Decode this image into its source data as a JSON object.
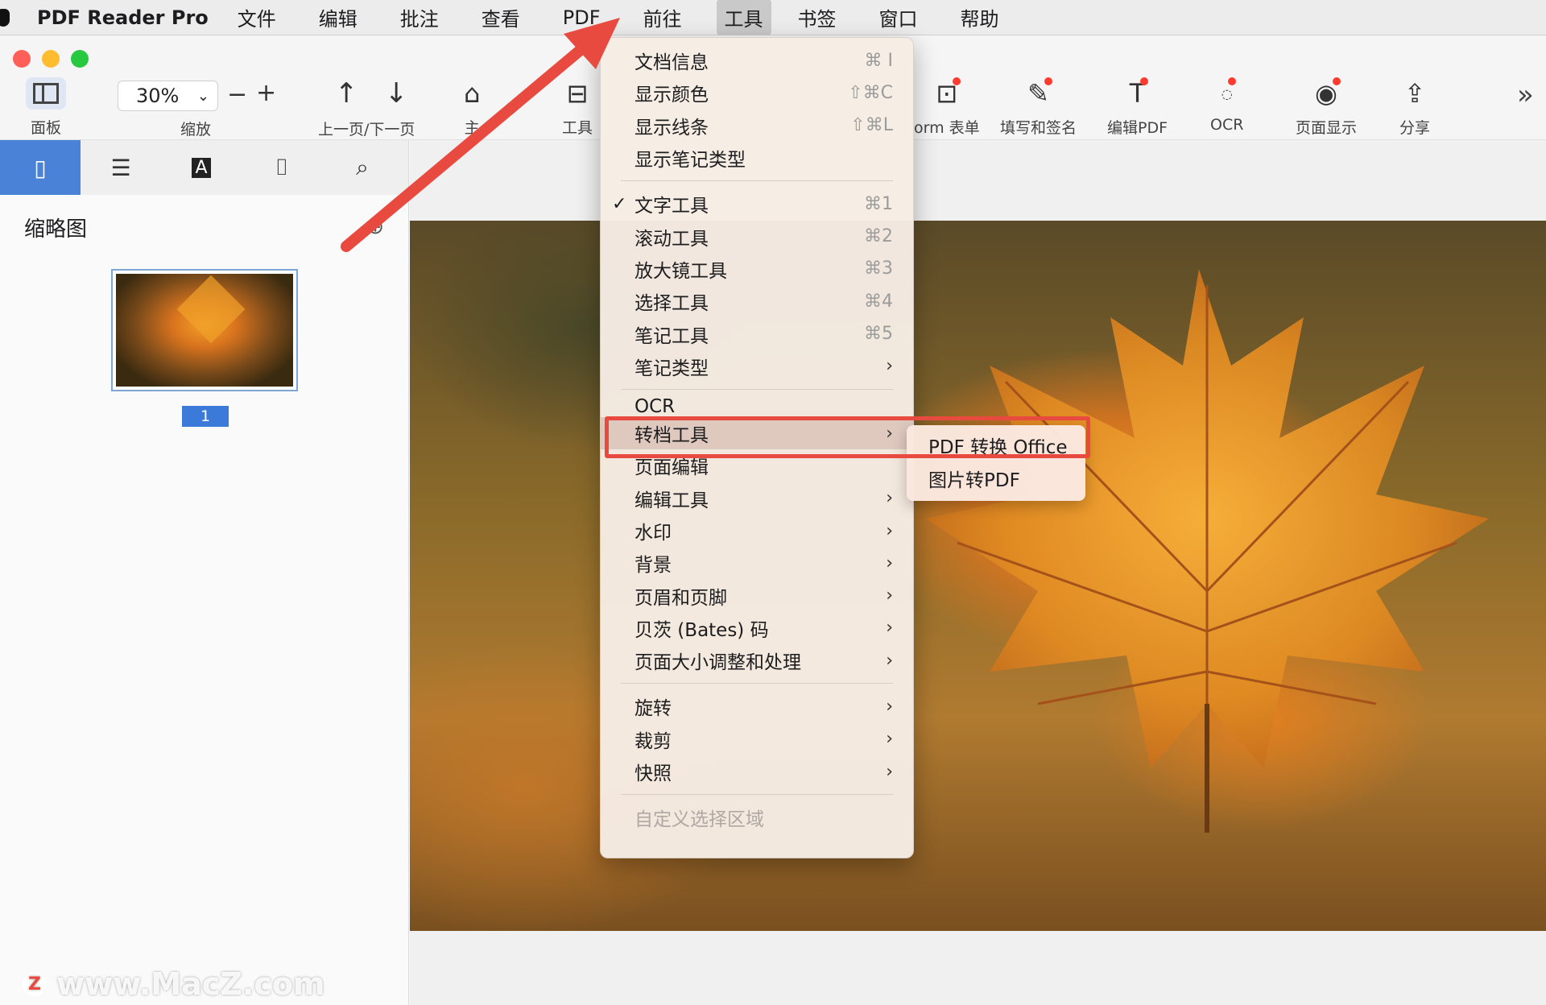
{
  "menubar": {
    "app_name": "PDF Reader Pro",
    "items": [
      "文件",
      "编辑",
      "批注",
      "查看",
      "PDF",
      "前往",
      "工具",
      "书签",
      "窗口",
      "帮助"
    ],
    "active_item": "工具"
  },
  "toolbar": {
    "panel_label": "面板",
    "zoom_value": "30%",
    "zoom_label": "缩放",
    "nav_label": "上一页/下一页",
    "home_label": "主",
    "tools_label": "工具",
    "form_label": "orm 表单",
    "fill_sign_label": "填写和签名",
    "edit_pdf_label": "编辑PDF",
    "ocr_label": "OCR",
    "page_display_label": "页面显示",
    "share_label": "分享"
  },
  "sidebar": {
    "title": "缩略图",
    "page_number": "1"
  },
  "menu": {
    "items": [
      {
        "label": "文档信息",
        "shortcut": "⌘ I"
      },
      {
        "label": "显示颜色",
        "shortcut": "⇧⌘C"
      },
      {
        "label": "显示线条",
        "shortcut": "⇧⌘L"
      },
      {
        "label": "显示笔记类型",
        "shortcut": ""
      },
      {
        "label": "文字工具",
        "shortcut": "⌘1",
        "checked": true
      },
      {
        "label": "滚动工具",
        "shortcut": "⌘2"
      },
      {
        "label": "放大镜工具",
        "shortcut": "⌘3"
      },
      {
        "label": "选择工具",
        "shortcut": "⌘4"
      },
      {
        "label": "笔记工具",
        "shortcut": "⌘5"
      },
      {
        "label": "笔记类型",
        "submenu": true
      },
      {
        "label": "OCR"
      },
      {
        "label": "转档工具",
        "submenu": true,
        "highlighted": true
      },
      {
        "label": "页面编辑"
      },
      {
        "label": "编辑工具",
        "submenu": true
      },
      {
        "label": "水印",
        "submenu": true
      },
      {
        "label": "背景",
        "submenu": true
      },
      {
        "label": "页眉和页脚",
        "submenu": true
      },
      {
        "label": "贝茨 (Bates) 码",
        "submenu": true
      },
      {
        "label": "页面大小调整和处理",
        "submenu": true
      },
      {
        "label": "旋转",
        "submenu": true
      },
      {
        "label": "裁剪",
        "submenu": true
      },
      {
        "label": "快照",
        "submenu": true
      },
      {
        "label": "自定义选择区域",
        "disabled": true
      }
    ]
  },
  "submenu": {
    "items": [
      "PDF 转换 Office",
      "图片转PDF"
    ]
  },
  "watermark": {
    "text": "www.MacZ.com",
    "logo": "Z"
  },
  "colors": {
    "accent": "#4a82d8",
    "annotation": "#e84a3f"
  }
}
